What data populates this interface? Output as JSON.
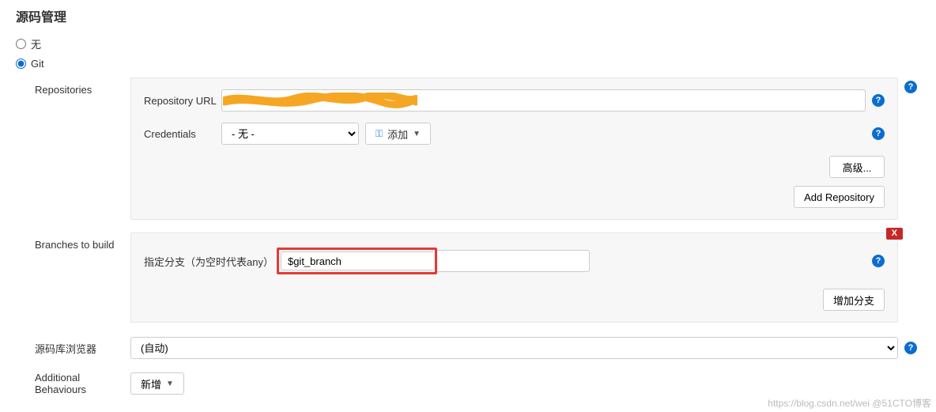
{
  "title": "源码管理",
  "scm_options": {
    "none": {
      "label": "无",
      "checked": false
    },
    "git": {
      "label": "Git",
      "checked": true
    }
  },
  "repositories": {
    "section_label": "Repositories",
    "url_label": "Repository URL",
    "url_value": "",
    "cred_label": "Credentials",
    "cred_selected": "- 无 -",
    "add_cred_label": "添加",
    "advanced_btn": "高级...",
    "add_repo_btn": "Add Repository"
  },
  "branches": {
    "section_label": "Branches to build",
    "branch_label": "指定分支（为空时代表any）",
    "branch_value": "$git_branch",
    "delete_label": "X",
    "add_branch_btn": "增加分支"
  },
  "repo_browser": {
    "label": "源码库浏览器",
    "selected": "(自动)"
  },
  "additional": {
    "label": "Additional Behaviours",
    "add_btn": "新增"
  },
  "watermark": "https://blog.csdn.net/wei @51CTO博客"
}
